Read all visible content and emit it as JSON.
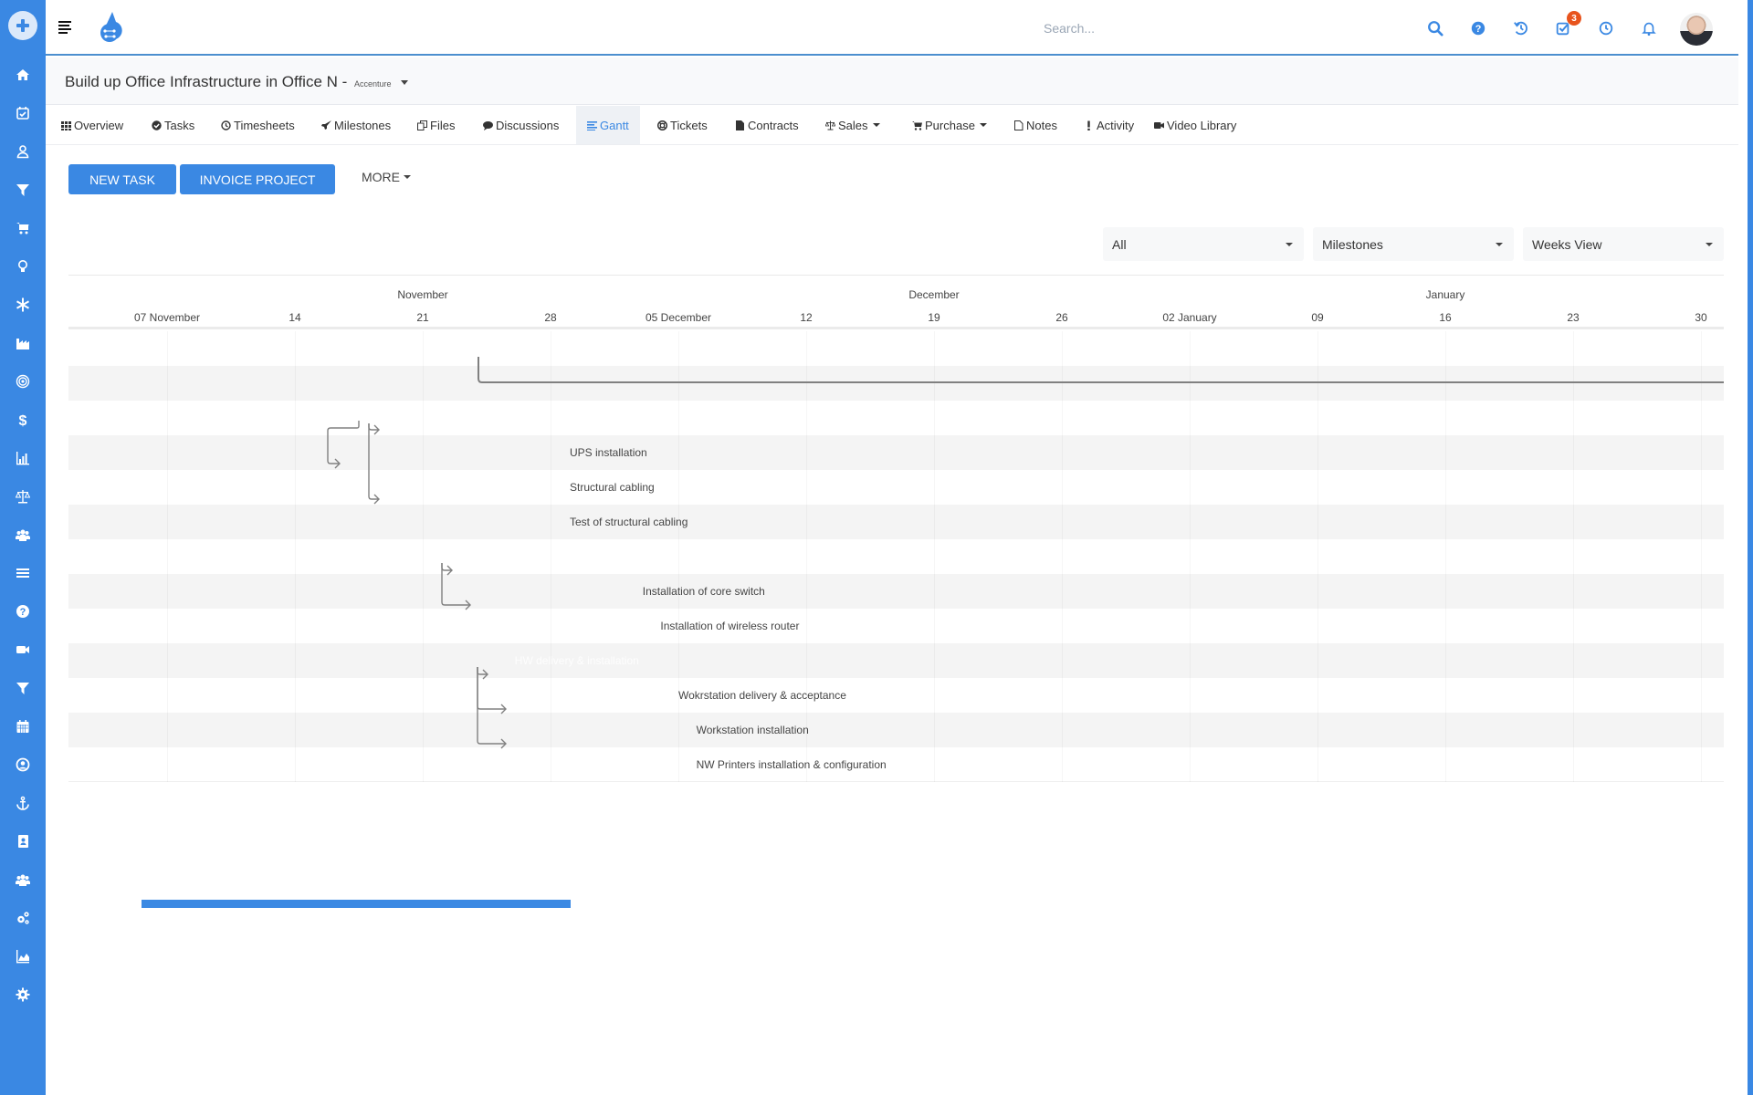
{
  "sidebar": {
    "add_button": "add-icon",
    "items": [
      {
        "name": "home",
        "icon": "home-icon"
      },
      {
        "name": "tasks",
        "icon": "calendar-check-icon"
      },
      {
        "name": "contacts",
        "icon": "user-icon"
      },
      {
        "name": "leads",
        "icon": "filter-icon"
      },
      {
        "name": "shop",
        "icon": "cart-icon"
      },
      {
        "name": "ideas",
        "icon": "lightbulb-icon"
      },
      {
        "name": "services",
        "icon": "snowflake-icon"
      },
      {
        "name": "manufacturing",
        "icon": "factory-icon"
      },
      {
        "name": "goals",
        "icon": "target-icon"
      },
      {
        "name": "finance",
        "icon": "dollar-icon"
      },
      {
        "name": "reports",
        "icon": "bar-chart-icon"
      },
      {
        "name": "legal",
        "icon": "scale-icon"
      },
      {
        "name": "teams",
        "icon": "users-icon"
      },
      {
        "name": "menu",
        "icon": "list-icon"
      },
      {
        "name": "help",
        "icon": "question-icon"
      },
      {
        "name": "videos",
        "icon": "video-icon"
      },
      {
        "name": "funnel",
        "icon": "filter-icon"
      },
      {
        "name": "calendar",
        "icon": "calendar-icon"
      },
      {
        "name": "profile",
        "icon": "user-circle-icon"
      },
      {
        "name": "anchor",
        "icon": "anchor-icon"
      },
      {
        "name": "address-book",
        "icon": "address-book-icon"
      },
      {
        "name": "groups",
        "icon": "users-icon"
      },
      {
        "name": "system",
        "icon": "gears-icon"
      },
      {
        "name": "analytics",
        "icon": "area-chart-icon"
      },
      {
        "name": "settings",
        "icon": "gear-icon"
      }
    ]
  },
  "header": {
    "search_placeholder": "Search...",
    "notification_count": "3",
    "icons": [
      "search-icon",
      "help-icon",
      "history-icon",
      "task-check-icon",
      "clock-icon",
      "bell-icon"
    ]
  },
  "project": {
    "title": "Build up Office Infrastructure in Office N - ",
    "client": "Accenture"
  },
  "tabs": [
    {
      "label": "Overview",
      "icon": "grid-icon"
    },
    {
      "label": "Tasks",
      "icon": "check-circle-icon"
    },
    {
      "label": "Timesheets",
      "icon": "clock-icon"
    },
    {
      "label": "Milestones",
      "icon": "rocket-icon"
    },
    {
      "label": "Files",
      "icon": "files-icon"
    },
    {
      "label": "Discussions",
      "icon": "comment-icon"
    },
    {
      "label": "Gantt",
      "icon": "gantt-icon",
      "active": true
    },
    {
      "label": "Tickets",
      "icon": "life-ring-icon"
    },
    {
      "label": "Contracts",
      "icon": "file-icon"
    },
    {
      "label": "Sales",
      "icon": "scale-icon",
      "dropdown": true
    },
    {
      "label": "Purchase",
      "icon": "cart-icon",
      "dropdown": true
    },
    {
      "label": "Notes",
      "icon": "note-icon"
    },
    {
      "label": "Activity",
      "icon": "exclamation-icon"
    },
    {
      "label": "Video Library",
      "icon": "video-icon"
    }
  ],
  "actions": {
    "new_task": "NEW TASK",
    "invoice_project": "INVOICE PROJECT",
    "more": "MORE"
  },
  "filters": {
    "status": "All",
    "group_by": "Milestones",
    "view": "Weeks View"
  },
  "gantt": {
    "months": [
      {
        "label": "November",
        "week_index": 2
      },
      {
        "label": "December",
        "week_index": 6
      },
      {
        "label": "January",
        "week_index": 10
      }
    ],
    "weeks": [
      "07 November",
      "14",
      "21",
      "28",
      "05 December",
      "12",
      "19",
      "26",
      "02 January",
      "09",
      "16",
      "23",
      "30"
    ],
    "rows": [
      {
        "label": ""
      },
      {
        "label": ""
      },
      {
        "label": ""
      },
      {
        "label": "UPS installation"
      },
      {
        "label": "Structural cabling"
      },
      {
        "label": "Test of structural cabling"
      },
      {
        "label": ""
      },
      {
        "label": "Installation of core switch"
      },
      {
        "label": "Installation of wireless router"
      },
      {
        "label": "HW delivery & installation",
        "ghost": true
      },
      {
        "label": "Wokrstation delivery & acceptance"
      },
      {
        "label": "Workstation installation"
      },
      {
        "label": "NW Printers installation & configuration"
      }
    ],
    "label_start_weeks": [
      null,
      null,
      null,
      3.15,
      3.15,
      3.15,
      null,
      3.72,
      3.86,
      2.72,
      4.0,
      4.14,
      4.14
    ]
  },
  "colors": {
    "primary": "#3a88e3",
    "badge": "#e8541d",
    "link_line": "#808080"
  }
}
